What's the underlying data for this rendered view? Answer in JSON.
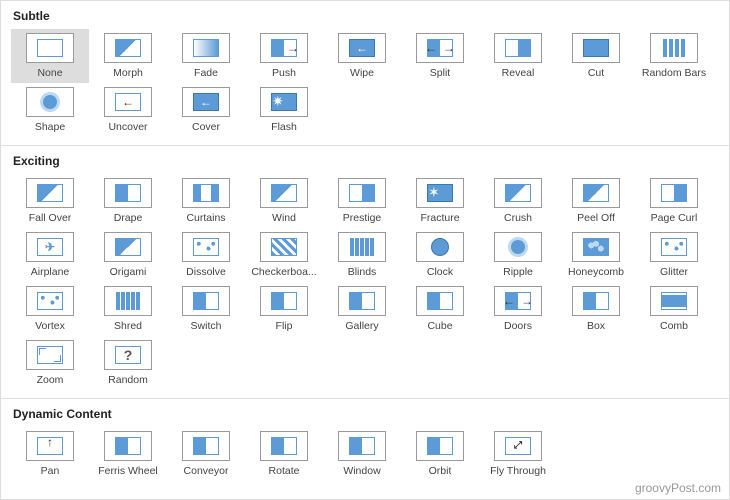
{
  "watermark": "groovyPost.com",
  "sections": [
    {
      "title": "Subtle",
      "items": [
        {
          "label": "None",
          "icon": "none",
          "selected": true
        },
        {
          "label": "Morph",
          "icon": "diagonal"
        },
        {
          "label": "Fade",
          "icon": "grad"
        },
        {
          "label": "Push",
          "icon": "push"
        },
        {
          "label": "Wipe",
          "icon": "wipe"
        },
        {
          "label": "Split",
          "icon": "split"
        },
        {
          "label": "Reveal",
          "icon": "reveal"
        },
        {
          "label": "Cut",
          "icon": "cut"
        },
        {
          "label": "Random Bars",
          "icon": "bars"
        },
        {
          "label": "Shape",
          "icon": "shape"
        },
        {
          "label": "Uncover",
          "icon": "uncover"
        },
        {
          "label": "Cover",
          "icon": "cover"
        },
        {
          "label": "Flash",
          "icon": "flash"
        }
      ]
    },
    {
      "title": "Exciting",
      "items": [
        {
          "label": "Fall Over",
          "icon": "diagonal"
        },
        {
          "label": "Drape",
          "icon": "half"
        },
        {
          "label": "Curtains",
          "icon": "curtains"
        },
        {
          "label": "Wind",
          "icon": "diagonal"
        },
        {
          "label": "Prestige",
          "icon": "halfr"
        },
        {
          "label": "Fracture",
          "icon": "fracture"
        },
        {
          "label": "Crush",
          "icon": "diagonal"
        },
        {
          "label": "Peel Off",
          "icon": "diagonal"
        },
        {
          "label": "Page Curl",
          "icon": "halfr"
        },
        {
          "label": "Airplane",
          "icon": "airplane"
        },
        {
          "label": "Origami",
          "icon": "diagonal"
        },
        {
          "label": "Dissolve",
          "icon": "glitter"
        },
        {
          "label": "Checkerboa...",
          "icon": "chk"
        },
        {
          "label": "Blinds",
          "icon": "blinds"
        },
        {
          "label": "Clock",
          "icon": "clock"
        },
        {
          "label": "Ripple",
          "icon": "shape"
        },
        {
          "label": "Honeycomb",
          "icon": "honey"
        },
        {
          "label": "Glitter",
          "icon": "glitter"
        },
        {
          "label": "Vortex",
          "icon": "glitter"
        },
        {
          "label": "Shred",
          "icon": "blinds"
        },
        {
          "label": "Switch",
          "icon": "half"
        },
        {
          "label": "Flip",
          "icon": "half"
        },
        {
          "label": "Gallery",
          "icon": "half"
        },
        {
          "label": "Cube",
          "icon": "half"
        },
        {
          "label": "Doors",
          "icon": "split"
        },
        {
          "label": "Box",
          "icon": "half"
        },
        {
          "label": "Comb",
          "icon": "comb"
        },
        {
          "label": "Zoom",
          "icon": "corners"
        },
        {
          "label": "Random",
          "icon": "random"
        }
      ]
    },
    {
      "title": "Dynamic Content",
      "items": [
        {
          "label": "Pan",
          "icon": "pan"
        },
        {
          "label": "Ferris Wheel",
          "icon": "half"
        },
        {
          "label": "Conveyor",
          "icon": "half"
        },
        {
          "label": "Rotate",
          "icon": "half"
        },
        {
          "label": "Window",
          "icon": "half"
        },
        {
          "label": "Orbit",
          "icon": "half"
        },
        {
          "label": "Fly Through",
          "icon": "flythrough"
        }
      ]
    }
  ]
}
